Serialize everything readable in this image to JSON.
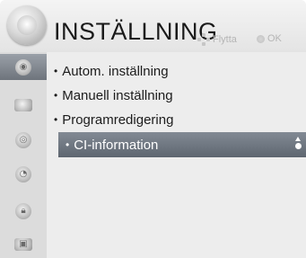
{
  "header": {
    "title": "INSTÄLLNING",
    "hint_move": "Flytta",
    "hint_ok": "OK",
    "icon": "settings-dial-icon"
  },
  "sidebar": {
    "items": [
      {
        "icon": "disc-icon",
        "active": true
      },
      {
        "icon": "display-icon",
        "active": false
      },
      {
        "icon": "speaker-icon",
        "active": false
      },
      {
        "icon": "clock-icon",
        "active": false
      },
      {
        "icon": "lock-icon",
        "active": false
      },
      {
        "icon": "options-icon",
        "active": false
      }
    ]
  },
  "menu": {
    "items": [
      {
        "label": "Autom. inställning",
        "selected": false
      },
      {
        "label": "Manuell inställning",
        "selected": false
      },
      {
        "label": "Programredigering",
        "selected": false
      },
      {
        "label": "CI-information",
        "selected": true
      }
    ],
    "bullet": "•"
  },
  "colors": {
    "selection": "#6e767f",
    "background": "#ebebeb"
  }
}
